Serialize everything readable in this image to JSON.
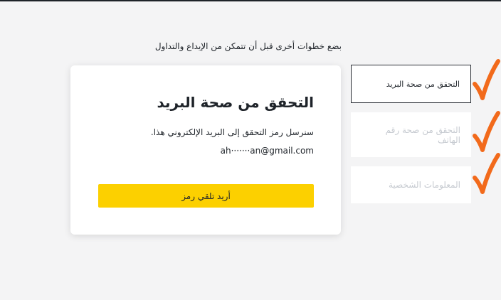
{
  "header": {
    "subtitle": "بضع خطوات أخرى قبل أن تتمكن من الإيداع والتداول"
  },
  "verification_card": {
    "title": "التحقق من صحة البريد",
    "description": "سنرسل رمز التحقق إلى البريد الإلكتروني هذا.",
    "email": "ah·······an@gmail.com",
    "button_label": "أريد تلقي رمز"
  },
  "steps": [
    {
      "label": "التحقق من صحة البريد",
      "status": "active"
    },
    {
      "label": "التحقق من صحة رقم الهاتف",
      "status": "pending"
    },
    {
      "label": "المعلومات الشخصية",
      "status": "pending"
    }
  ],
  "colors": {
    "accent": "#fcd000",
    "annotation_checkmark": "#f26a1b",
    "disabled_text": "#c7cbd1"
  }
}
